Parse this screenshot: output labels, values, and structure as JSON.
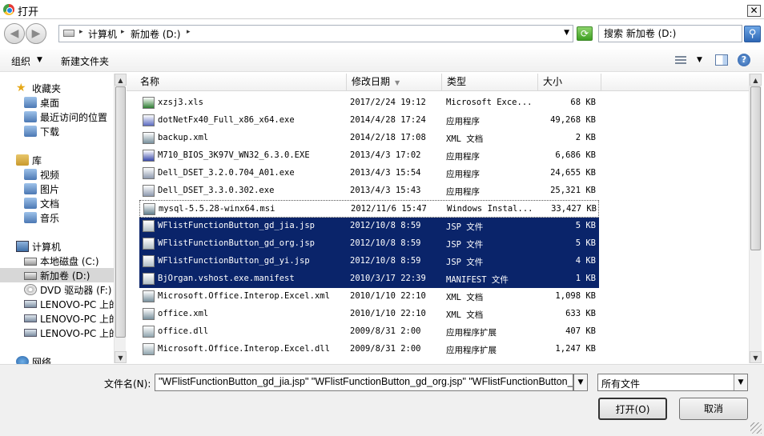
{
  "window": {
    "title": "打开",
    "close_glyph": "✕"
  },
  "nav": {
    "back_glyph": "◀",
    "forward_glyph": "▶",
    "breadcrumb": [
      "计算机",
      "新加卷 (D:)"
    ],
    "search_placeholder": "搜索 新加卷 (D:)"
  },
  "toolbar": {
    "organize_label": "组织",
    "new_folder_label": "新建文件夹"
  },
  "sidebar": {
    "items": [
      {
        "label": "收藏夹",
        "icon": "star-icon"
      },
      {
        "label": "桌面",
        "icon": "desktop-icon"
      },
      {
        "label": "最近访问的位置",
        "icon": "recent-places-icon"
      },
      {
        "label": "下载",
        "icon": "downloads-icon"
      },
      {
        "label": "库",
        "icon": "library-icon"
      },
      {
        "label": "视频",
        "icon": "video-icon"
      },
      {
        "label": "图片",
        "icon": "pictures-icon"
      },
      {
        "label": "文档",
        "icon": "documents-icon"
      },
      {
        "label": "音乐",
        "icon": "music-icon"
      },
      {
        "label": "计算机",
        "icon": "computer-icon"
      },
      {
        "label": "本地磁盘 (C:)",
        "icon": "local-disk-icon"
      },
      {
        "label": "新加卷 (D:)",
        "icon": "drive-icon",
        "selected": true
      },
      {
        "label": "DVD 驱动器 (F:)",
        "icon": "dvd-drive-icon"
      },
      {
        "label": "LENOVO-PC 上的",
        "icon": "network-drive-icon"
      },
      {
        "label": "LENOVO-PC 上的",
        "icon": "network-drive-icon"
      },
      {
        "label": "LENOVO-PC 上的",
        "icon": "network-drive-icon"
      },
      {
        "label": "网络",
        "icon": "network-icon"
      }
    ]
  },
  "columns": {
    "name": "名称",
    "date": "修改日期",
    "type": "类型",
    "size": "大小"
  },
  "files": [
    {
      "name": "xzsj3.xls",
      "date": "2017/2/24 19:12",
      "type": "Microsoft Exce...",
      "size": "68 KB",
      "icon": "excel-file-icon",
      "color": "#2e7d32"
    },
    {
      "name": "dotNetFx40_Full_x86_x64.exe",
      "date": "2014/4/28 17:24",
      "type": "应用程序",
      "size": "49,268 KB",
      "icon": "installer-icon",
      "color": "#5c6bc0"
    },
    {
      "name": "backup.xml",
      "date": "2014/2/18 17:08",
      "type": "XML 文档",
      "size": "2 KB",
      "icon": "xml-file-icon",
      "color": "#78909c"
    },
    {
      "name": "M710_BIOS_3K97V_WN32_6.3.0.EXE",
      "date": "2013/4/3 17:02",
      "type": "应用程序",
      "size": "6,686 KB",
      "icon": "bios-exe-icon",
      "color": "#3949ab"
    },
    {
      "name": "Dell_DSET_3.2.0.704_A01.exe",
      "date": "2013/4/3 15:54",
      "type": "应用程序",
      "size": "24,655 KB",
      "icon": "setup-exe-icon",
      "color": "#8d99ae"
    },
    {
      "name": "Dell_DSET_3.3.0.302.exe",
      "date": "2013/4/3 15:43",
      "type": "应用程序",
      "size": "25,321 KB",
      "icon": "setup-exe-icon",
      "color": "#8d99ae"
    },
    {
      "name": "mysql-5.5.28-winx64.msi",
      "date": "2012/11/6 15:47",
      "type": "Windows Instal...",
      "size": "33,427 KB",
      "icon": "msi-file-icon",
      "color": "#607d8b",
      "focus": true
    },
    {
      "name": "WFlistFunctionButton_gd_jia.jsp",
      "date": "2012/10/8 8:59",
      "type": "JSP 文件",
      "size": "5 KB",
      "icon": "jsp-file-icon",
      "color": "#b0bec5",
      "selected": true
    },
    {
      "name": "WFlistFunctionButton_gd_org.jsp",
      "date": "2012/10/8 8:59",
      "type": "JSP 文件",
      "size": "5 KB",
      "icon": "jsp-file-icon",
      "color": "#b0bec5",
      "selected": true
    },
    {
      "name": "WFlistFunctionButton_gd_yi.jsp",
      "date": "2012/10/8 8:59",
      "type": "JSP 文件",
      "size": "4 KB",
      "icon": "jsp-file-icon",
      "color": "#b0bec5",
      "selected": true
    },
    {
      "name": "BjOrgan.vshost.exe.manifest",
      "date": "2010/3/17 22:39",
      "type": "MANIFEST 文件",
      "size": "1 KB",
      "icon": "manifest-file-icon",
      "color": "#b0bec5",
      "selected": true
    },
    {
      "name": "Microsoft.Office.Interop.Excel.xml",
      "date": "2010/1/10 22:10",
      "type": "XML 文档",
      "size": "1,098 KB",
      "icon": "xml-file-icon",
      "color": "#78909c"
    },
    {
      "name": "office.xml",
      "date": "2010/1/10 22:10",
      "type": "XML 文档",
      "size": "633 KB",
      "icon": "xml-file-icon",
      "color": "#78909c"
    },
    {
      "name": "office.dll",
      "date": "2009/8/31 2:00",
      "type": "应用程序扩展",
      "size": "407 KB",
      "icon": "dll-file-icon",
      "color": "#90a4ae"
    },
    {
      "name": "Microsoft.Office.Interop.Excel.dll",
      "date": "2009/8/31 2:00",
      "type": "应用程序扩展",
      "size": "1,247 KB",
      "icon": "dll-file-icon",
      "color": "#90a4ae"
    }
  ],
  "footer": {
    "filename_label": "文件名(N):",
    "filename_value": "\"WFlistFunctionButton_gd_jia.jsp\" \"WFlistFunctionButton_gd_org.jsp\" \"WFlistFunctionButton_gd_yi.jsp\" \"BjOrgan.vshost.exe.manifest\"",
    "filetype_value": "所有文件",
    "open_label": "打开(O)",
    "cancel_label": "取消"
  },
  "colors": {
    "selection": "#0a246a",
    "panel": "#f0f0f0"
  }
}
